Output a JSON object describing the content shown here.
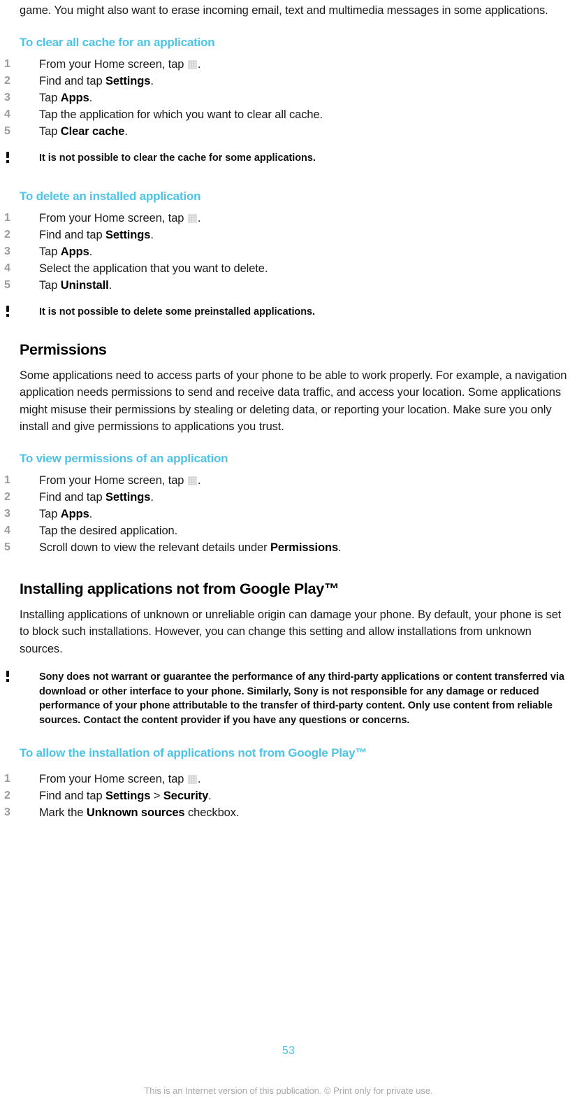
{
  "document": {
    "page_number": "53",
    "footer_text": "This is an Internet version of this publication. © Print only for private use.",
    "accent_color": "#4ec3e8",
    "step_number_color": "#9b9b9b"
  },
  "content": {
    "intro_paragraph": "game. You might also want to erase incoming email, text and multimedia messages in some applications.",
    "clear_cache": {
      "heading": "To clear all cache for an application",
      "steps": [
        {
          "prefix": "From your Home screen, tap ",
          "icon": "app-grid-icon",
          "suffix": "."
        },
        {
          "prefix": "Find and tap ",
          "bold": "Settings",
          "suffix": "."
        },
        {
          "prefix": "Tap ",
          "bold": "Apps",
          "suffix": "."
        },
        {
          "prefix": "Tap the application for which you want to clear all cache.",
          "bold": "",
          "suffix": ""
        },
        {
          "prefix": "Tap ",
          "bold": "Clear cache",
          "suffix": "."
        }
      ],
      "note": "It is not possible to clear the cache for some applications."
    },
    "delete_application": {
      "heading": "To delete an installed application",
      "steps": [
        {
          "prefix": "From your Home screen, tap ",
          "icon": "app-grid-icon",
          "suffix": "."
        },
        {
          "prefix": "Find and tap ",
          "bold": "Settings",
          "suffix": "."
        },
        {
          "prefix": "Tap ",
          "bold": "Apps",
          "suffix": "."
        },
        {
          "prefix": "Select the application that you want to delete.",
          "bold": "",
          "suffix": ""
        },
        {
          "prefix": "Tap ",
          "bold": "Uninstall",
          "suffix": "."
        }
      ],
      "note": "It is not possible to delete some preinstalled applications."
    },
    "permissions": {
      "heading": "Permissions",
      "paragraph": "Some applications need to access parts of your phone to be able to work properly. For example, a navigation application needs permissions to send and receive data traffic, and access your location. Some applications might misuse their permissions by stealing or deleting data, or reporting your location. Make sure you only install and give permissions to applications you trust.",
      "view_permissions": {
        "heading": "To view permissions of an application",
        "steps": [
          {
            "prefix": "From your Home screen, tap ",
            "icon": "app-grid-icon",
            "suffix": "."
          },
          {
            "prefix": "Find and tap ",
            "bold": "Settings",
            "suffix": "."
          },
          {
            "prefix": "Tap ",
            "bold": "Apps",
            "suffix": "."
          },
          {
            "prefix": "Tap the desired application.",
            "bold": "",
            "suffix": ""
          },
          {
            "prefix": "Scroll down to view the relevant details under ",
            "bold": "Permissions",
            "suffix": "."
          }
        ]
      }
    },
    "installing_not_google_play": {
      "heading": "Installing applications not from Google Play™",
      "paragraph": "Installing applications of unknown or unreliable origin can damage your phone. By default, your phone is set to block such installations. However, you can change this setting and allow installations from unknown sources.",
      "note": "Sony does not warrant or guarantee the performance of any third-party applications or content transferred via download or other interface to your phone. Similarly, Sony is not responsible for any damage or reduced performance of your phone attributable to the transfer of third-party content. Only use content from reliable sources. Contact the content provider if you have any questions or concerns.",
      "allow_install": {
        "heading": "To allow the installation of applications not from Google Play™",
        "steps": [
          {
            "prefix": "From your Home screen, tap ",
            "icon": "app-grid-icon",
            "suffix": "."
          },
          {
            "prefix": "Find and tap ",
            "bold": "Settings",
            "mid": " > ",
            "bold2": "Security",
            "suffix": "."
          },
          {
            "prefix": "Mark the ",
            "bold": "Unknown sources",
            "suffix": " checkbox."
          }
        ]
      }
    }
  }
}
